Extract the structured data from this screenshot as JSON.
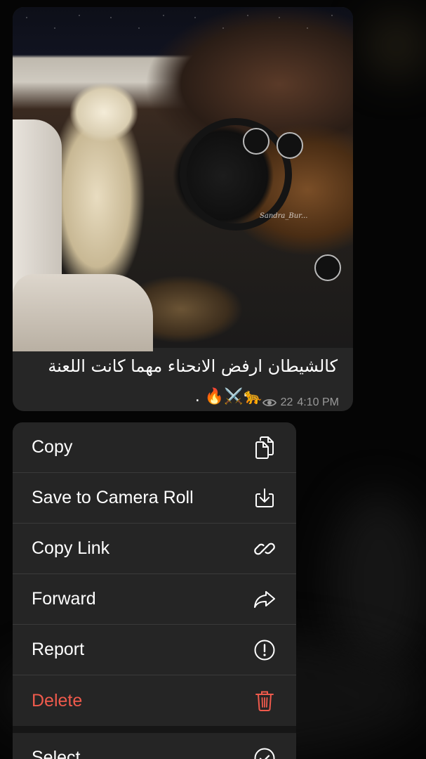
{
  "message": {
    "caption_line1": "كالشيطان ارفض الانحناء مهما كانت اللعنة",
    "caption_line2": "🐆⚔️🔥 .",
    "views": "22",
    "time": "4:10 PM",
    "watermark": "Sandra_Bur..."
  },
  "menu": {
    "items": [
      {
        "label": "Copy",
        "icon": "copy-icon"
      },
      {
        "label": "Save to Camera Roll",
        "icon": "download-icon"
      },
      {
        "label": "Copy Link",
        "icon": "link-icon"
      },
      {
        "label": "Forward",
        "icon": "forward-icon"
      },
      {
        "label": "Report",
        "icon": "report-icon"
      },
      {
        "label": "Delete",
        "icon": "trash-icon",
        "color": "#ef5a4c"
      },
      {
        "label": "Select",
        "icon": "check-circle-icon"
      }
    ]
  },
  "colors": {
    "background": "#050505",
    "bubble": "#262626",
    "menu": "#252525",
    "danger": "#ef5a4c",
    "meta": "#9a9a9a"
  }
}
